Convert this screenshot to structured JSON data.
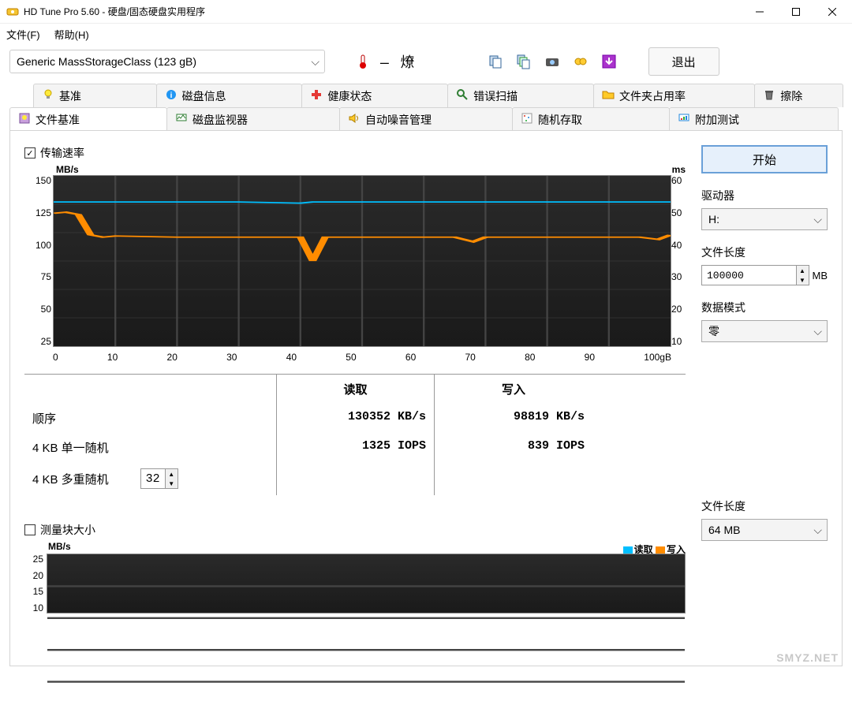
{
  "window": {
    "title": "HD Tune Pro 5.60 - 硬盘/固态硬盘实用程序"
  },
  "menu": {
    "file": "文件(F)",
    "help": "帮助(H)"
  },
  "toolbar": {
    "drive": "Generic MassStorageClass (123 gB)",
    "exit": "退出"
  },
  "tabs_row1": [
    {
      "label": "基准",
      "icon": "bulb"
    },
    {
      "label": "磁盘信息",
      "icon": "info"
    },
    {
      "label": "健康状态",
      "icon": "plus"
    },
    {
      "label": "错误扫描",
      "icon": "search"
    },
    {
      "label": "文件夹占用率",
      "icon": "folder"
    },
    {
      "label": "擦除",
      "icon": "trash"
    }
  ],
  "tabs_row2": [
    {
      "label": "文件基准",
      "icon": "file-bulb",
      "active": true
    },
    {
      "label": "磁盘监视器",
      "icon": "monitor"
    },
    {
      "label": "自动噪音管理",
      "icon": "speaker"
    },
    {
      "label": "随机存取",
      "icon": "random"
    },
    {
      "label": "附加测试",
      "icon": "extra"
    }
  ],
  "checkbox_transfer": {
    "checked": true,
    "label": "传输速率"
  },
  "start_button": "开始",
  "side": {
    "drive_label": "驱动器",
    "drive_value": "H:",
    "filelen_label": "文件长度",
    "filelen_value": "100000",
    "filelen_unit": "MB",
    "pattern_label": "数据模式",
    "pattern_value": "零",
    "filelen2_label": "文件长度",
    "filelen2_value": "64 MB"
  },
  "results": {
    "read_hdr": "读取",
    "write_hdr": "写入",
    "seq_label": "顺序",
    "seq_read": "130352 KB/s",
    "seq_write": "98819 KB/s",
    "rand4k_label": "4 KB 单一随机",
    "rand4k_read": "1325 IOPS",
    "rand4k_write": "839 IOPS",
    "rand4kmulti_label": "4 KB 多重随机",
    "rand4kmulti_qd": "32"
  },
  "checkbox_block": {
    "checked": false,
    "label": "测量块大小"
  },
  "chart2_legend": {
    "read": "读取",
    "write": "写入"
  },
  "watermark": "SMYZ.NET",
  "chart_data": [
    {
      "type": "line",
      "title": "传输速率",
      "ylabel": "MB/s",
      "ylim": [
        0,
        150
      ],
      "ylabel2": "ms",
      "ylim2": [
        0,
        60
      ],
      "xlabel": "gB",
      "xlim": [
        0,
        100
      ],
      "x_ticks": [
        0,
        10,
        20,
        30,
        40,
        50,
        60,
        70,
        80,
        90,
        100
      ],
      "y_ticks_left": [
        150,
        125,
        100,
        75,
        50,
        25
      ],
      "y_ticks_right": [
        60,
        50,
        40,
        30,
        20,
        10
      ],
      "series": [
        {
          "name": "读取",
          "color": "#00bfff",
          "x": [
            0,
            5,
            10,
            20,
            30,
            40,
            42,
            45,
            50,
            60,
            65,
            70,
            80,
            90,
            95,
            100
          ],
          "y": [
            127,
            127,
            127,
            127,
            127,
            126,
            127,
            127,
            127,
            127,
            127,
            127,
            127,
            127,
            127,
            127
          ]
        },
        {
          "name": "写入",
          "color": "#ff8c00",
          "x": [
            0,
            2,
            4,
            6,
            8,
            10,
            20,
            30,
            40,
            42,
            44,
            50,
            60,
            65,
            68,
            70,
            80,
            90,
            95,
            98,
            100
          ],
          "y": [
            117,
            118,
            116,
            98,
            96,
            97,
            96,
            96,
            96,
            75,
            96,
            96,
            96,
            96,
            92,
            96,
            96,
            96,
            96,
            94,
            98
          ]
        }
      ]
    },
    {
      "type": "line",
      "title": "测量块大小",
      "ylabel": "MB/s",
      "ylim": [
        0,
        25
      ],
      "y_ticks_left": [
        25,
        20,
        15,
        10
      ],
      "series": [
        {
          "name": "读取",
          "color": "#00bfff",
          "x": [],
          "y": []
        },
        {
          "name": "写入",
          "color": "#ff8c00",
          "x": [],
          "y": []
        }
      ]
    }
  ]
}
